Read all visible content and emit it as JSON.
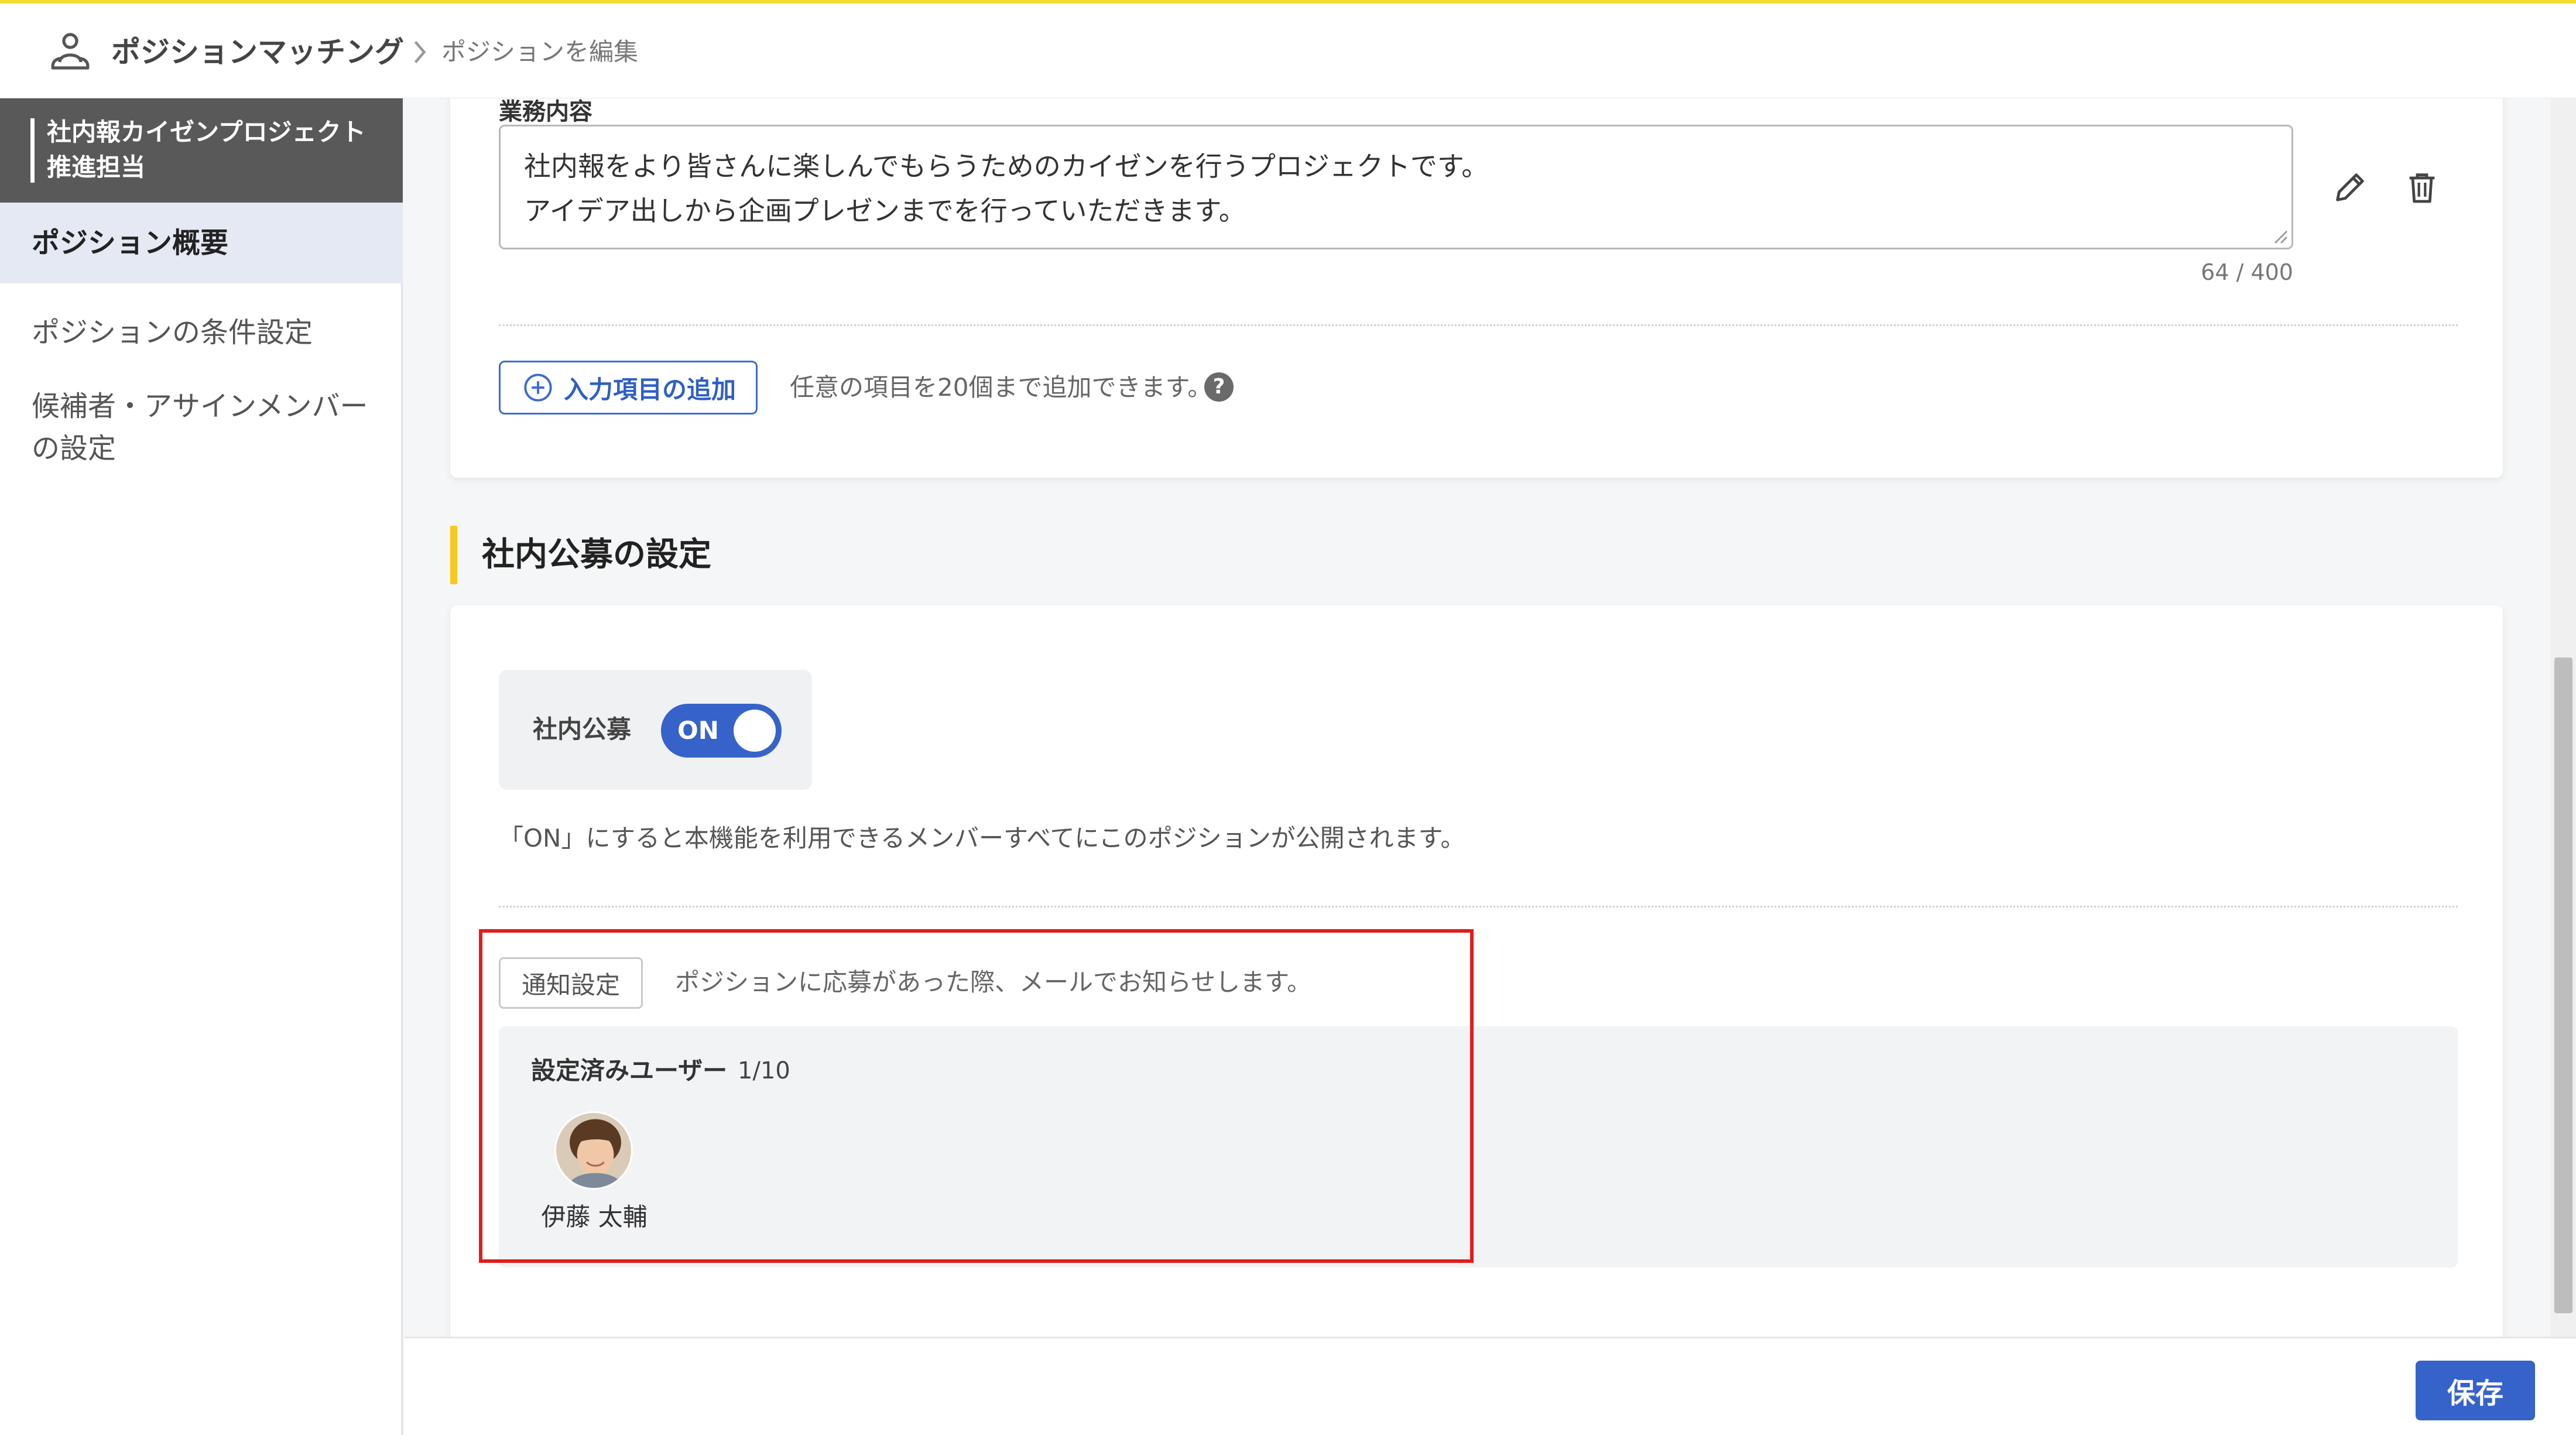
{
  "header": {
    "app_title": "ポジションマッチング",
    "breadcrumb_current": "ポジションを編集"
  },
  "sidebar": {
    "project_name": "社内報カイゼンプロジェクト推進担当",
    "items": [
      {
        "label": "ポジション概要",
        "active": true
      },
      {
        "label": "ポジションの条件設定",
        "active": false
      },
      {
        "label": "候補者・アサインメンバーの設定",
        "active": false
      }
    ]
  },
  "task_field": {
    "label": "業務内容",
    "value_line1": "社内報をより皆さんに楽しんでもらうためのカイゼンを行うプロジェクトです。",
    "value_line2": "アイデア出しから企画プレゼンまでを行っていただきます。",
    "char_count": "64 / 400"
  },
  "add_item": {
    "button_label": "入力項目の追加",
    "hint": "任意の項目を20個まで追加できます。",
    "help_glyph": "?"
  },
  "recruit_section": {
    "title": "社内公募の設定",
    "toggle_label": "社内公募",
    "toggle_state": "ON",
    "toggle_description": "「ON」にすると本機能を利用できるメンバーすべてにこのポジションが公開されます。",
    "notify_tag": "通知設定",
    "notify_description": "ポジションに応募があった際、メールでお知らせします。",
    "users_title": "設定済みユーザー",
    "users_count": "1/10",
    "users": [
      {
        "name": "伊藤 太輔"
      }
    ]
  },
  "footer": {
    "save_label": "保存"
  },
  "colors": {
    "accent_blue": "#3563c9",
    "section_bar_yellow": "#f5c91d",
    "top_border_yellow": "#f2dc2e",
    "highlight_red": "#e11d1d",
    "sidebar_header_gray": "#595959"
  }
}
